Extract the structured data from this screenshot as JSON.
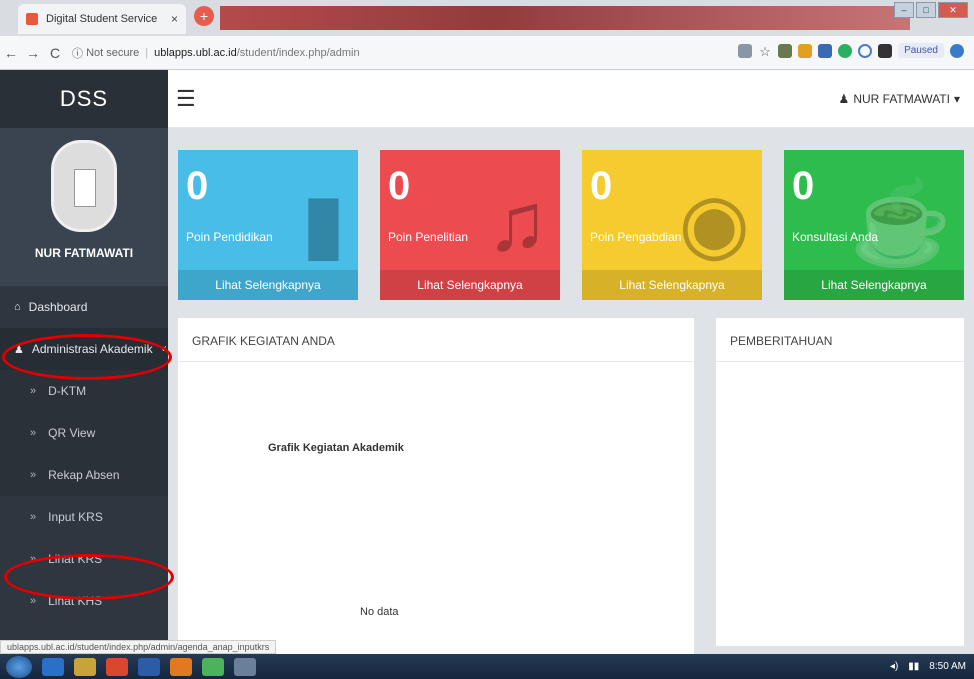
{
  "browser": {
    "tab_title": "Digital Student Service",
    "tab_close": "×",
    "new_tab": "+",
    "url_secure": "Not secure",
    "url_host": "ublapps.ubl.ac.id",
    "url_path": "/student/index.php/admin",
    "paused_label": "Paused",
    "status_link": "ublapps.ubl.ac.id/student/index.php/admin/agenda_anap_inputkrs"
  },
  "sidebar": {
    "logo": "DSS",
    "profile_name": "NUR FATMAWATI",
    "items": [
      {
        "label": "Dashboard",
        "icon": "dashboard-icon"
      },
      {
        "label": "Administrasi Akademik",
        "icon": "user-icon"
      }
    ],
    "submenu": [
      {
        "label": "D-KTM"
      },
      {
        "label": "QR View"
      },
      {
        "label": "Rekap Absen"
      },
      {
        "label": "Input KRS"
      },
      {
        "label": "Lihat KRS"
      },
      {
        "label": "Lihat KHS"
      }
    ]
  },
  "header": {
    "user_name": "NUR FATMAWATI"
  },
  "stats": [
    {
      "value": "0",
      "label": "Poin Pendidikan",
      "link": "Lihat Selengkapnya",
      "color": "#47bde8",
      "icon": "book-icon"
    },
    {
      "value": "0",
      "label": "Poin Penelitian",
      "link": "Lihat Selengkapnya",
      "color": "#ec4b4f",
      "icon": "music-icon"
    },
    {
      "value": "0",
      "label": "Poin Pengabdian",
      "link": "Lihat Selengkapnya",
      "color": "#f5cb2f",
      "icon": "camera-icon"
    },
    {
      "value": "0",
      "label": "Konsultasi Anda",
      "link": "Lihat Selengkapnya",
      "color": "#2ebd4c",
      "icon": "cup-icon"
    }
  ],
  "panels": {
    "chart_heading": "GRAFIK KEGIATAN ANDA",
    "chart_title": "Grafik Kegiatan Akademik",
    "no_data": "No data",
    "notif_heading": "PEMBERITAHUAN"
  },
  "taskbar": {
    "time": "8:50 AM"
  }
}
